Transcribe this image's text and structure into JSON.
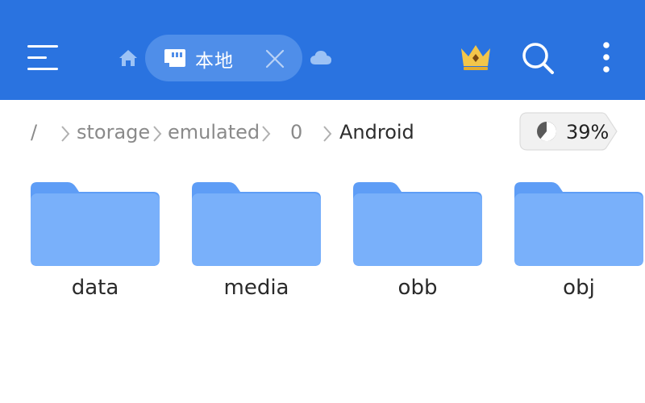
{
  "header": {
    "tab_label": "本地"
  },
  "breadcrumb": {
    "root": "/",
    "items": [
      "storage",
      "emulated",
      "0",
      "Android"
    ]
  },
  "storage": {
    "usage_percent": 39,
    "label": "39%"
  },
  "folders": [
    {
      "name": "data"
    },
    {
      "name": "media"
    },
    {
      "name": "obb"
    },
    {
      "name": "obj"
    }
  ],
  "icons": {
    "menu": "menu-icon",
    "home": "home-icon",
    "sd_card": "sd-card-icon",
    "close": "close-icon",
    "cloud": "cloud-icon",
    "crown": "crown-icon",
    "search": "search-icon",
    "more": "more-vertical-icon",
    "pie": "pie-chart-icon",
    "folder": "folder-icon"
  },
  "colors": {
    "header_bg": "#2a73e0",
    "tab_bg": "#4f8ee9",
    "folder_back": "#5e9df6",
    "folder_front": "#79b0fa",
    "crown": "#f3c64a"
  }
}
